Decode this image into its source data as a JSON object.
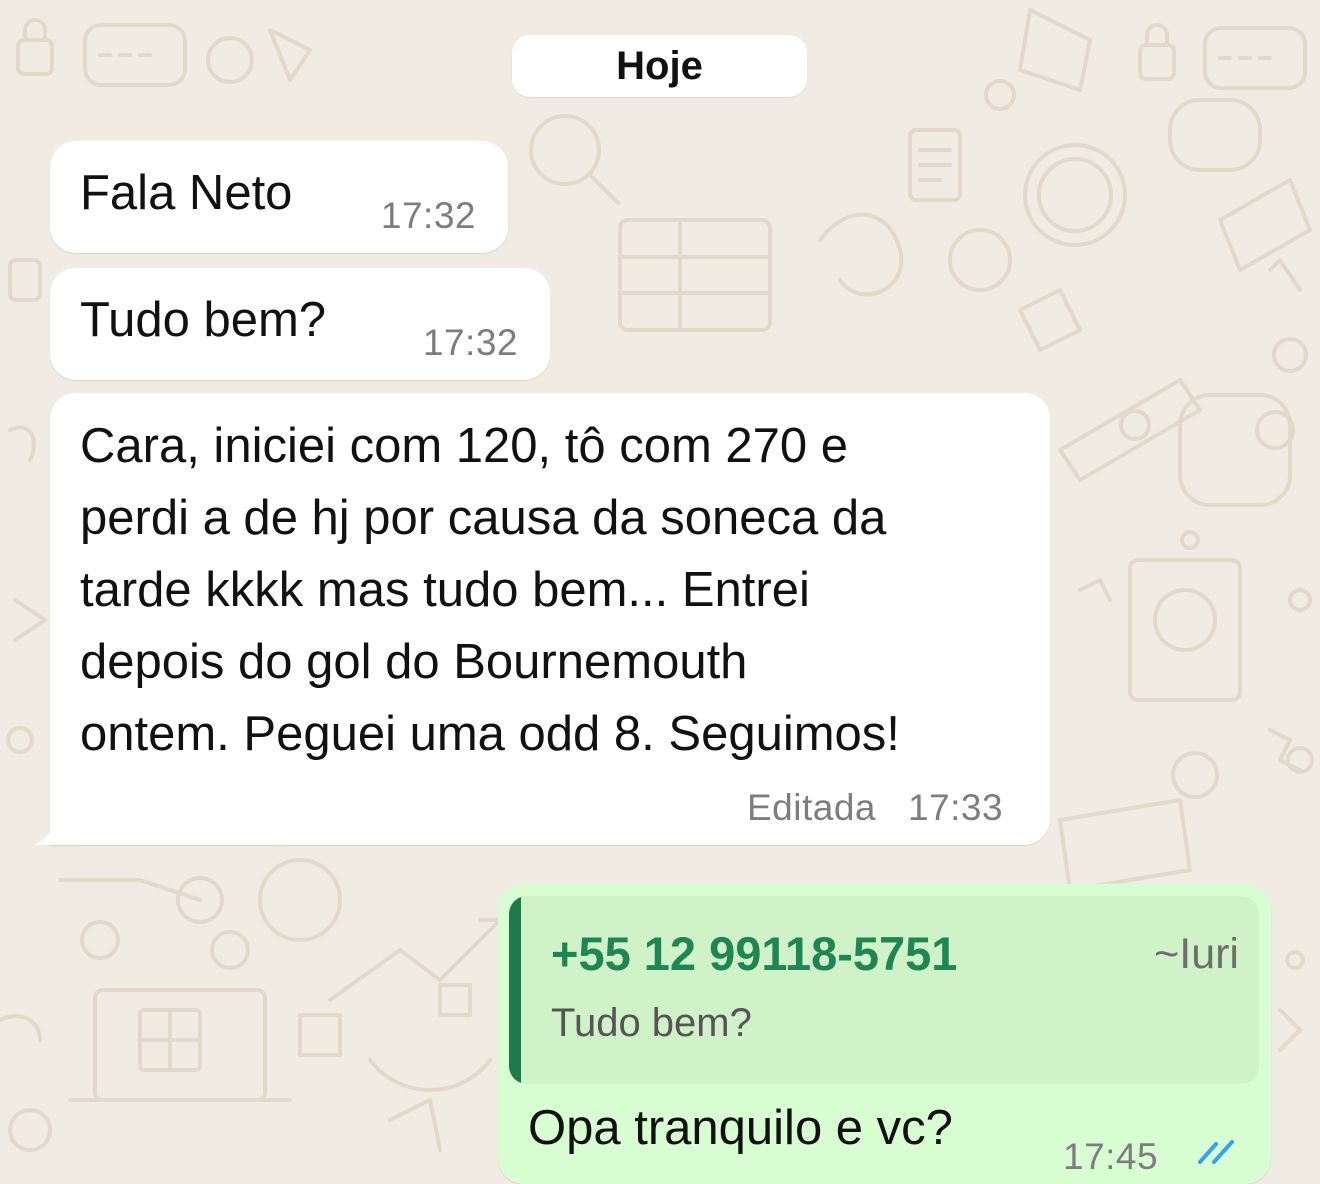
{
  "chat": {
    "date_divider": "Hoje",
    "messages": [
      {
        "direction": "incoming",
        "text": "Fala Neto",
        "time": "17:32"
      },
      {
        "direction": "incoming",
        "text": "Tudo bem?",
        "time": "17:32"
      },
      {
        "direction": "incoming",
        "text": "Cara, iniciei com 120, tô com 270 e\nperdi a de hj por causa da soneca da\ntarde kkkk mas tudo bem... Entrei\ndepois do gol do Bournemouth\nontem. Peguei uma odd 8. Seguimos!",
        "edited_label": "Editada",
        "time": "17:33"
      },
      {
        "direction": "outgoing",
        "reply_to": {
          "author": "+55 12 99118-5751",
          "push_name": "~Iuri",
          "text": "Tudo bem?"
        },
        "text": "Opa tranquilo e vc?",
        "time": "17:45",
        "status_icon": "double-check-read-icon"
      }
    ]
  },
  "colors": {
    "wallpaper": "#f0ebe3",
    "incoming_bubble": "#ffffff",
    "outgoing_bubble": "#d9fdd3",
    "quote_background": "#cff2c8",
    "quote_bar": "#1f7a4a",
    "quote_author": "#1f8552",
    "timestamp": "#7d7d7d",
    "read_check": "#34a3e8"
  }
}
